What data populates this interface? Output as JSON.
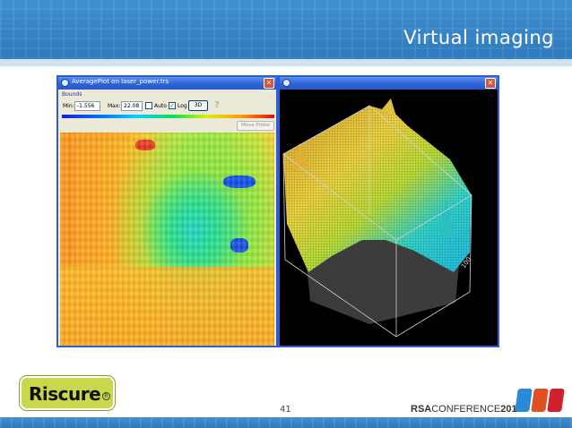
{
  "slide": {
    "title": "Virtual imaging",
    "page_number": "41"
  },
  "left_window": {
    "title": "AveragePlot on laser_power.trs",
    "bounds_label": "Bounds",
    "min_label": "Min:",
    "min_value": "-1.556",
    "max_label": "Max:",
    "max_value": "22.08",
    "auto_label": "Auto",
    "auto_checked": false,
    "log_label": "Log",
    "log_checked": true,
    "btn_3d": "3D",
    "help": "?",
    "move_probe": "Move Probe",
    "close": "✕"
  },
  "right_window": {
    "close": "✕",
    "axis_tick": "100"
  },
  "footer": {
    "logo_text": "Riscure",
    "logo_reg": "R",
    "rsa_bold": "RSA",
    "rsa_rest": "CONFERENCE",
    "rsa_year": "2010"
  },
  "colors": {
    "header_blue": "#2e79bd",
    "window_border": "#2b5fd0",
    "logo_green": "#c8d84a"
  }
}
